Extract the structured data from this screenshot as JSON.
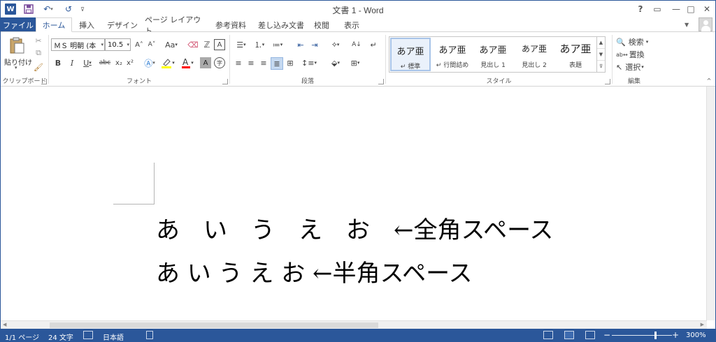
{
  "window": {
    "title": "文書 1 - Word",
    "help": "?",
    "ribbon_display": "▭",
    "minimize": "—",
    "maximize": "□",
    "close": "✕"
  },
  "qat": {
    "logo": "W",
    "save_icon": "save-icon",
    "undo": "↶",
    "undo_caret": "▾",
    "redo": "↺",
    "more": "⊽"
  },
  "tabs": {
    "file": "ファイル",
    "items": [
      "ホーム",
      "挿入",
      "デザイン",
      "ページ レイアウト",
      "参考資料",
      "差し込み文書",
      "校閲",
      "表示"
    ],
    "active_index": 0
  },
  "clipboard": {
    "paste": "貼り付け",
    "paste_caret": "▾",
    "label": "クリップボード"
  },
  "font": {
    "family": "ＭＳ 明朝 (本",
    "size": "10.5",
    "grow": "A˄",
    "shrink": "A˅",
    "case": "Aa",
    "bold": "B",
    "italic": "I",
    "underline": "U",
    "strike": "abc",
    "subscript": "x₂",
    "superscript": "x²",
    "label": "フォント"
  },
  "paragraph": {
    "label": "段落"
  },
  "styles": {
    "label": "スタイル",
    "items": [
      {
        "sample": "あア亜",
        "name": "↵ 標準"
      },
      {
        "sample": "あア亜",
        "name": "↵ 行間詰め"
      },
      {
        "sample": "あア亜",
        "name": "見出し 1"
      },
      {
        "sample": "あア亜",
        "name": "見出し 2"
      },
      {
        "sample": "あア亜",
        "name": "表題"
      }
    ]
  },
  "editing": {
    "find": "検索",
    "replace": "置換",
    "select": "選択",
    "label": "編集"
  },
  "document": {
    "line1": "あ　い　う　え　お　←全角スペース",
    "line2": "あ い う え お ←半角スペース"
  },
  "status": {
    "page": "1/1 ページ",
    "words": "24 文字",
    "language": "日本語",
    "zoom": "300%",
    "zoom_minus": "−",
    "zoom_plus": "+"
  },
  "colors": {
    "accent": "#2b579a",
    "highlight": "#ffff00",
    "font_color": "#ff0000"
  }
}
